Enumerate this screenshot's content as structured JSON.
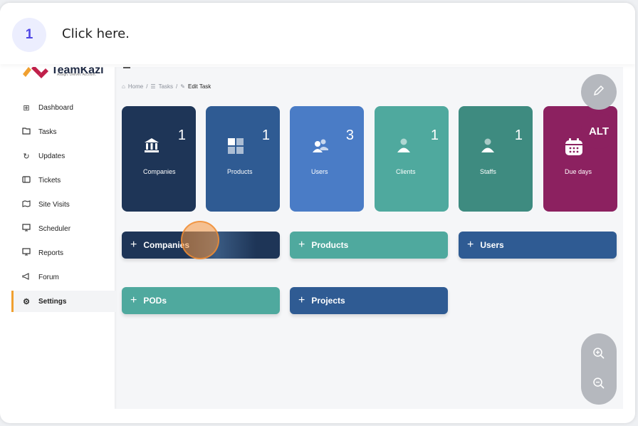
{
  "step": {
    "number": "1",
    "instruction": "Click here."
  },
  "logo": {
    "brand": "TeamKazi",
    "tagline": "Assign. Deliver. Account."
  },
  "sidebar": {
    "items": [
      {
        "label": "Dashboard",
        "icon": "grid-icon"
      },
      {
        "label": "Tasks",
        "icon": "folder-icon"
      },
      {
        "label": "Updates",
        "icon": "refresh-icon"
      },
      {
        "label": "Tickets",
        "icon": "ticket-icon"
      },
      {
        "label": "Site Visits",
        "icon": "map-icon"
      },
      {
        "label": "Scheduler",
        "icon": "presentation-icon"
      },
      {
        "label": "Reports",
        "icon": "presentation-icon"
      },
      {
        "label": "Forum",
        "icon": "megaphone-icon"
      },
      {
        "label": "Settings",
        "icon": "gear-icon"
      }
    ],
    "active": "Settings"
  },
  "breadcrumb": {
    "home": "Home",
    "tasks": "Tasks",
    "current": "Edit Task"
  },
  "cards": [
    {
      "label": "Companies",
      "count": "1",
      "color": "#1e3557",
      "icon": "bank-icon"
    },
    {
      "label": "Products",
      "count": "1",
      "color": "#2f5b93",
      "icon": "grid-icon"
    },
    {
      "label": "Users",
      "count": "3",
      "color": "#4a7cc6",
      "icon": "users-icon"
    },
    {
      "label": "Clients",
      "count": "1",
      "color": "#4fa99e",
      "icon": "user-icon"
    },
    {
      "label": "Staffs",
      "count": "1",
      "color": "#3e8b80",
      "icon": "user-icon"
    },
    {
      "label": "Due days",
      "count": "",
      "color": "#8c2160",
      "icon": "calendar-icon"
    }
  ],
  "buttons": [
    {
      "label": "Companies",
      "color": "#1e3557"
    },
    {
      "label": "Products",
      "color": "#4fa99e"
    },
    {
      "label": "Users",
      "color": "#2f5b93"
    },
    {
      "label": "PODs",
      "color": "#4fa99e"
    },
    {
      "label": "Projects",
      "color": "#2f5b93"
    }
  ],
  "fabs": {
    "edit_icon": "pencil-icon",
    "alt_label": "ALT",
    "zoom_in_icon": "zoom-in-icon",
    "zoom_out_icon": "zoom-out-icon"
  }
}
